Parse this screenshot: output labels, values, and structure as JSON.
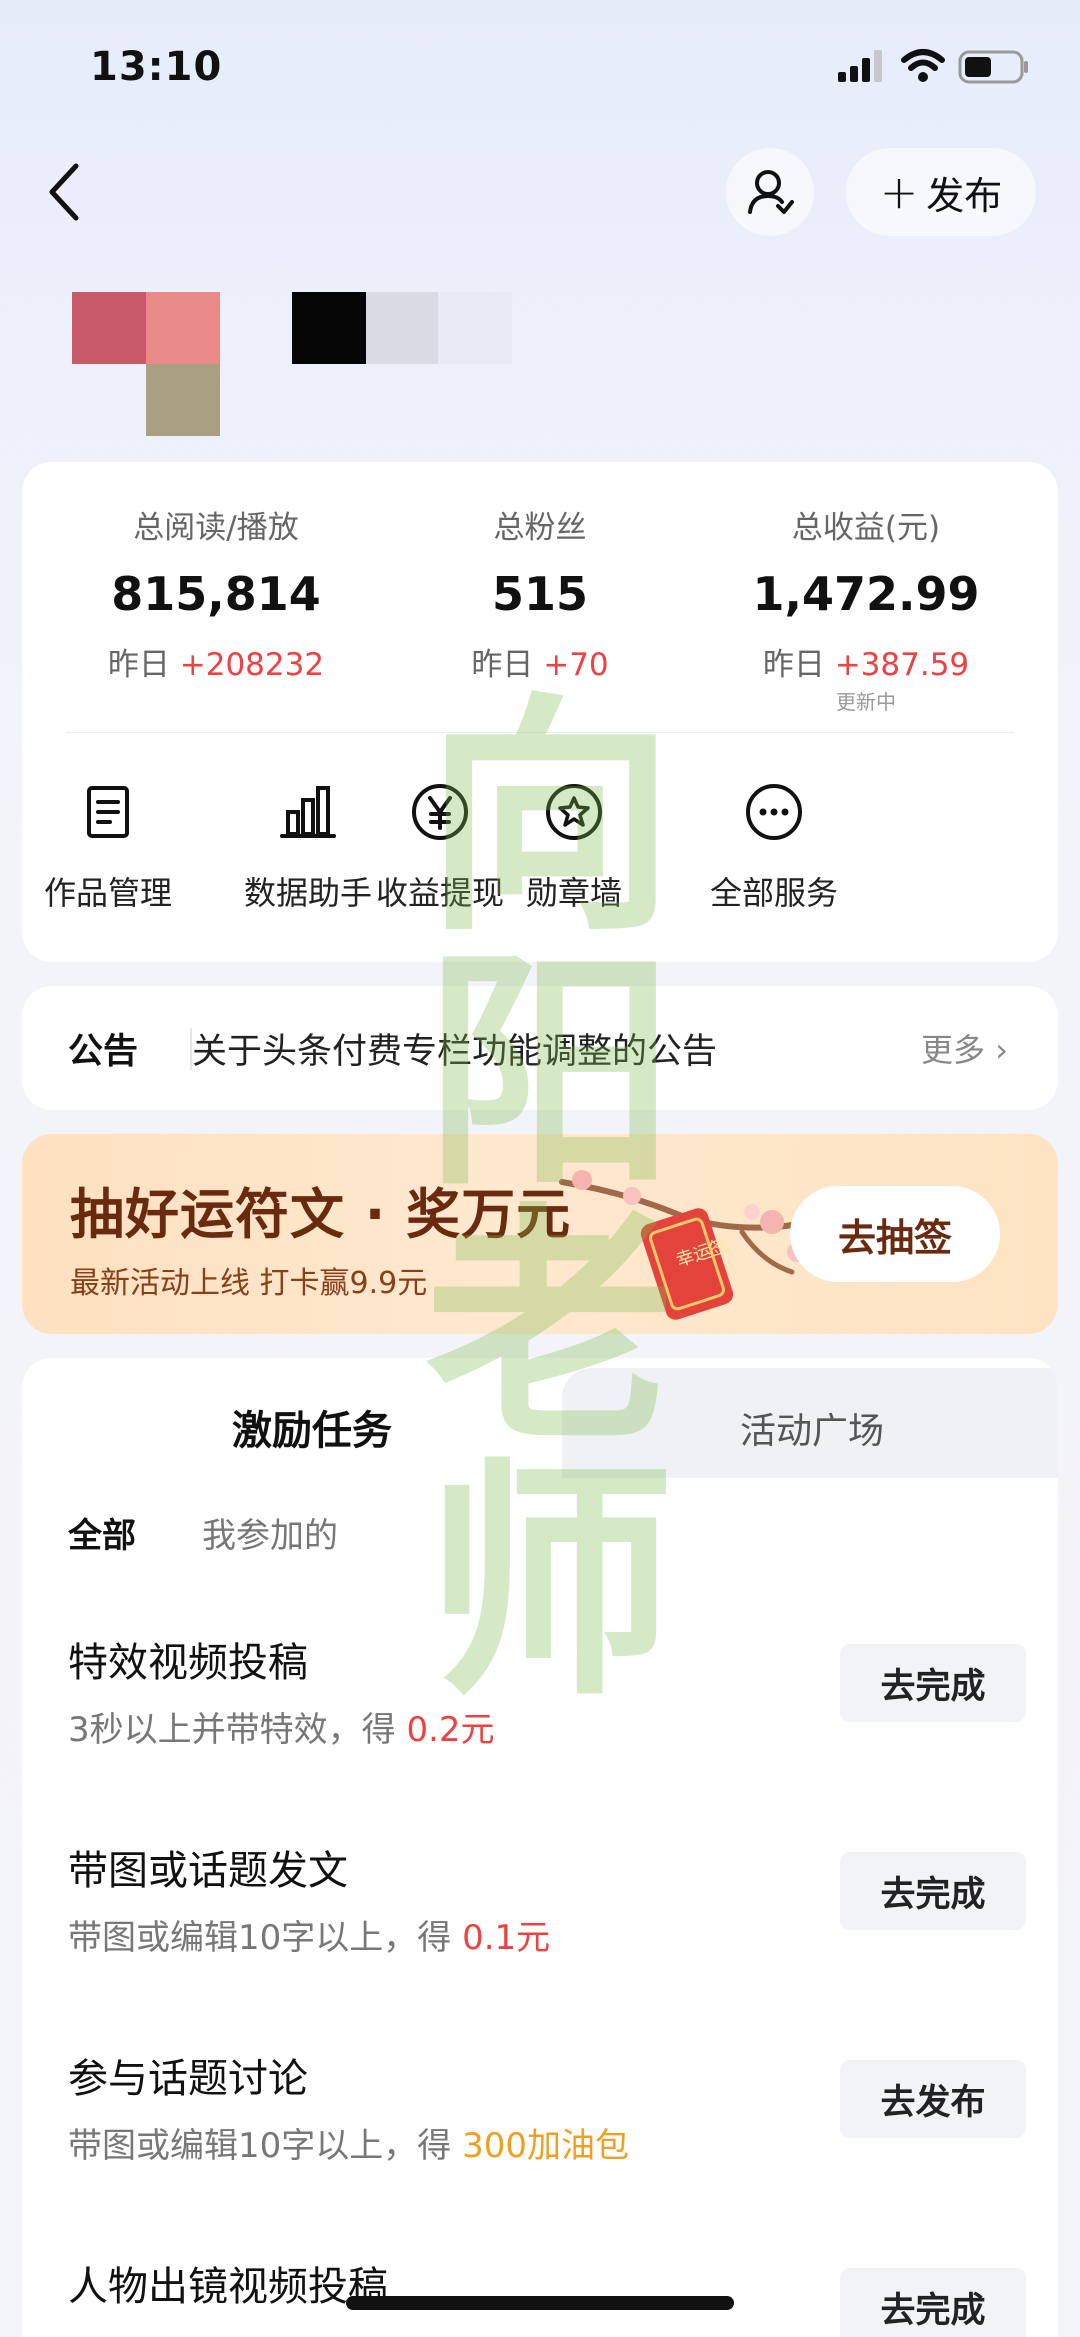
{
  "status_bar": {
    "time": "13:10"
  },
  "nav": {
    "publish_label": "发布",
    "publish_plus": "+"
  },
  "stats": [
    {
      "label": "总阅读/播放",
      "value": "815,814",
      "delta_prefix": "昨日 ",
      "delta": "+208232",
      "sub": ""
    },
    {
      "label": "总粉丝",
      "value": "515",
      "delta_prefix": "昨日 ",
      "delta": "+70",
      "sub": ""
    },
    {
      "label": "总收益(元)",
      "value": "1,472.99",
      "delta_prefix": "昨日 ",
      "delta": "+387.59",
      "sub": "更新中"
    }
  ],
  "services": [
    {
      "label": "作品管理",
      "icon": "document-icon"
    },
    {
      "label": "数据助手",
      "icon": "bar-chart-icon"
    },
    {
      "label": "收益提现",
      "icon": "yen-coin-icon"
    },
    {
      "label": "勋章墙",
      "icon": "medal-icon"
    },
    {
      "label": "全部服务",
      "icon": "more-icon"
    }
  ],
  "notice": {
    "title": "公告",
    "text": "关于头条付费专栏功能调整的公告",
    "more": "更多"
  },
  "banner": {
    "title": "抽好运符文 · 奖万元",
    "subtitle": "最新活动上线 打卡赢9.9元",
    "button": "去抽签",
    "charm_text": "幸运签"
  },
  "tabs": {
    "active": "激励任务",
    "inactive": "活动广场"
  },
  "filters": {
    "all": "全部",
    "mine": "我参加的"
  },
  "tasks": [
    {
      "title": "特效视频投稿",
      "desc": "3秒以上并带特效，得 ",
      "reward": "0.2元",
      "button": "去完成"
    },
    {
      "title": "带图或话题发文",
      "desc": "带图或编辑10字以上，得 ",
      "reward": "0.1元",
      "button": "去完成"
    },
    {
      "title": "参与话题讨论",
      "desc": "带图或编辑10字以上，得 ",
      "reward": "300加油包",
      "button": "去发布"
    },
    {
      "title": "人物出镜视频投稿",
      "desc": "",
      "reward": "",
      "button": "去完成"
    }
  ],
  "watermark": "向阳老师",
  "colors": {
    "accent_red": "#f04142",
    "reward_orange": "#f0a020",
    "banner_text": "#6a2a10"
  }
}
